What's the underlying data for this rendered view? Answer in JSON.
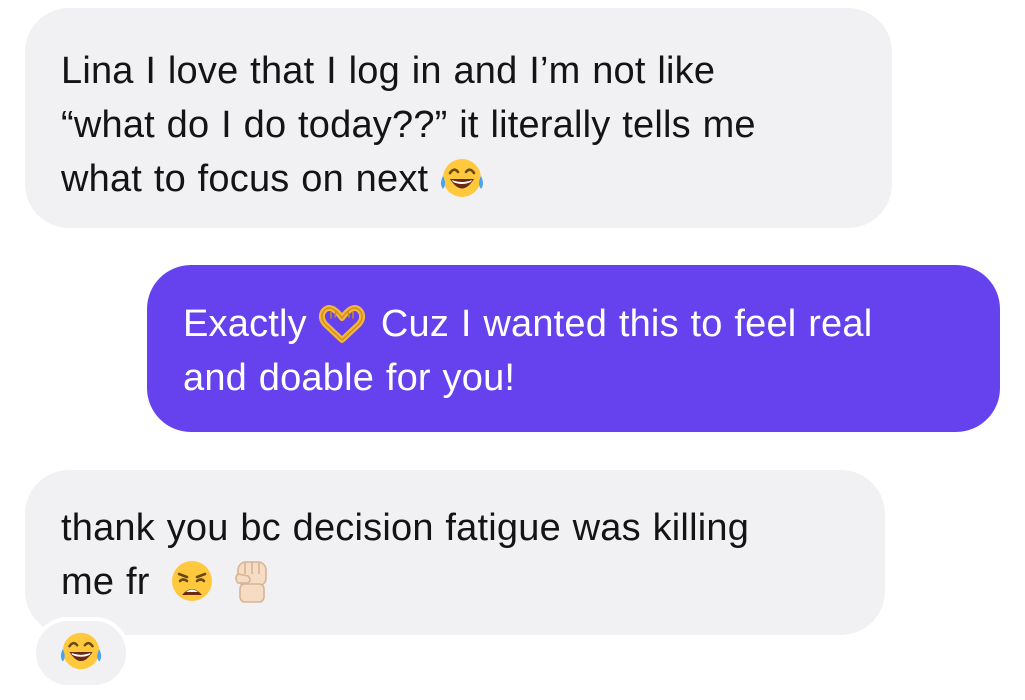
{
  "conversation": {
    "messages": [
      {
        "direction": "incoming",
        "lines": [
          "Lina I love that I log in and I’m not like",
          "“what do I do today??” it literally tells me",
          "what to focus on next"
        ],
        "emojis": [
          "face-with-tears-of-joy"
        ]
      },
      {
        "direction": "outgoing",
        "prefix": "Exactly",
        "prefix_emoji": "heart-hands",
        "lines": [
          "Cuz I wanted this to feel real",
          "and doable for you!"
        ]
      },
      {
        "direction": "incoming",
        "lines": [
          "thank you bc decision fatigue was killing",
          "me fr"
        ],
        "emojis": [
          "weary-face",
          "raised-fist-light-skin-tone"
        ]
      }
    ],
    "reaction": {
      "emoji": "face-with-tears-of-joy",
      "target": "message-3"
    }
  },
  "colors": {
    "incoming_bubble": "#f1f1f4",
    "incoming_text": "#141414",
    "outgoing_bubble": "#6542ee",
    "outgoing_text": "#ffffff",
    "background": "#ffffff"
  }
}
